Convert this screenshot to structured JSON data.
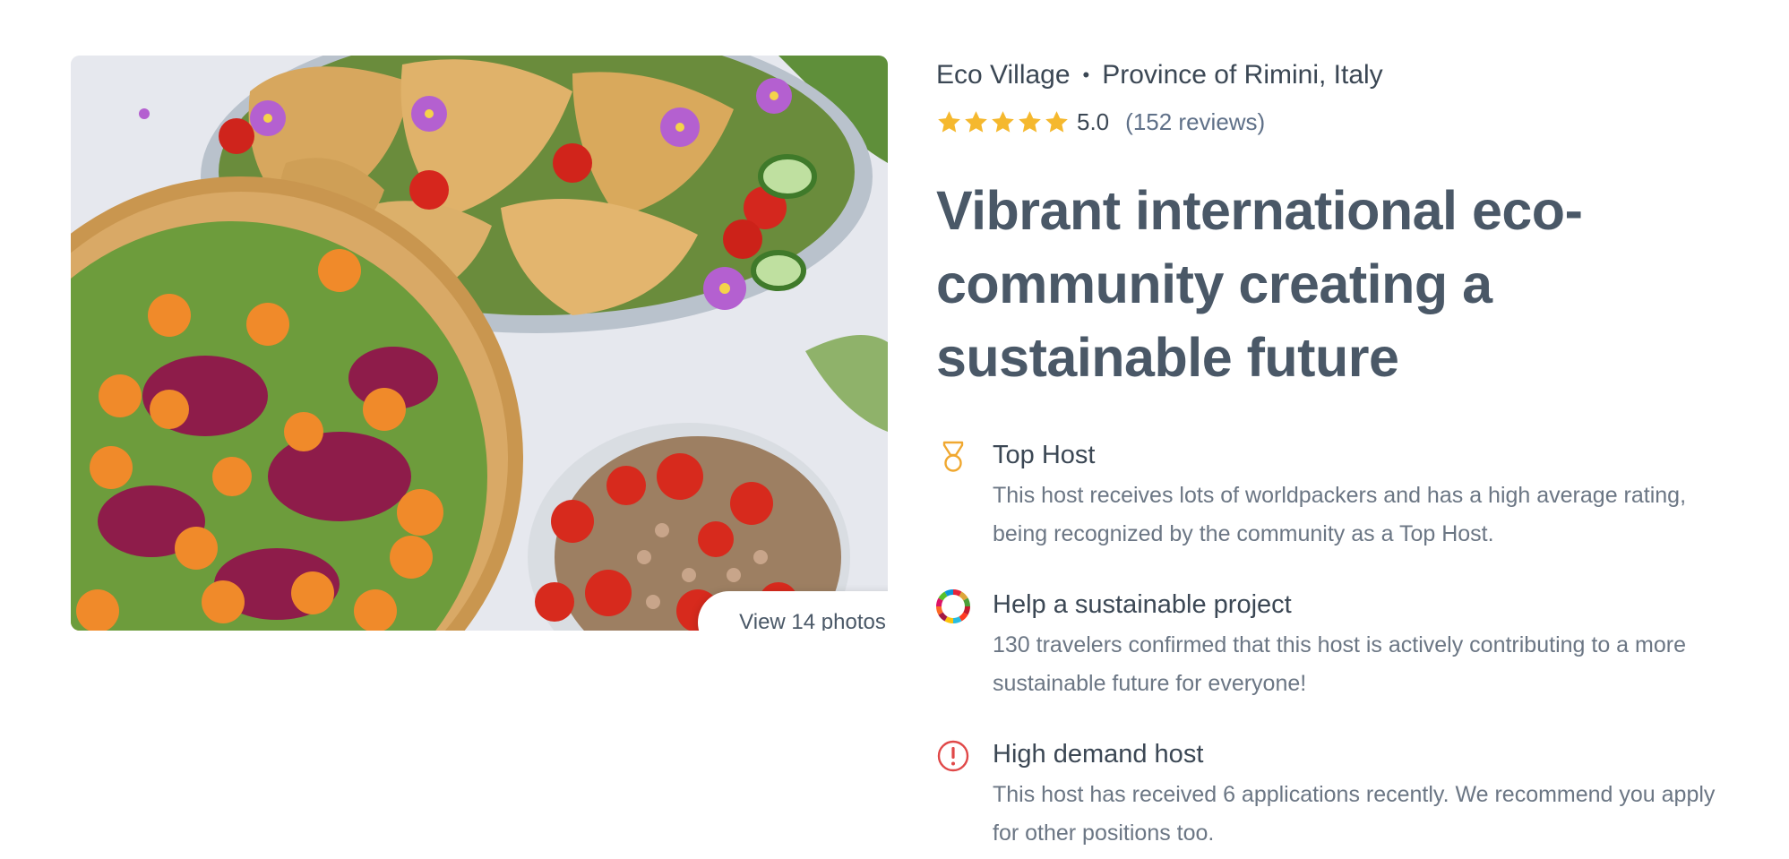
{
  "header": {
    "category": "Eco Village",
    "separator": "•",
    "location": "Province of Rimini, Italy"
  },
  "rating": {
    "stars": 5,
    "value": "5.0",
    "reviews_label": "(152 reviews)",
    "star_color": "#f5b82e"
  },
  "title": "Vibrant international eco-community creating a sustainable future",
  "photo": {
    "button_label": "View 14 photos"
  },
  "features": [
    {
      "icon": "medal-icon",
      "title": "Top Host",
      "description": "This host receives lots of worldpackers and has a high average rating, being recognized by the community as a Top Host.",
      "color": "#f0a830"
    },
    {
      "icon": "sdg-wheel-icon",
      "title": "Help a sustainable project",
      "description": "130 travelers confirmed that this host is actively contributing to a more sustainable future for everyone!"
    },
    {
      "icon": "alert-icon",
      "title": "High demand host",
      "description": "This host has received 6 applications recently. We recommend you apply for other positions too.",
      "color": "#e04848"
    }
  ]
}
